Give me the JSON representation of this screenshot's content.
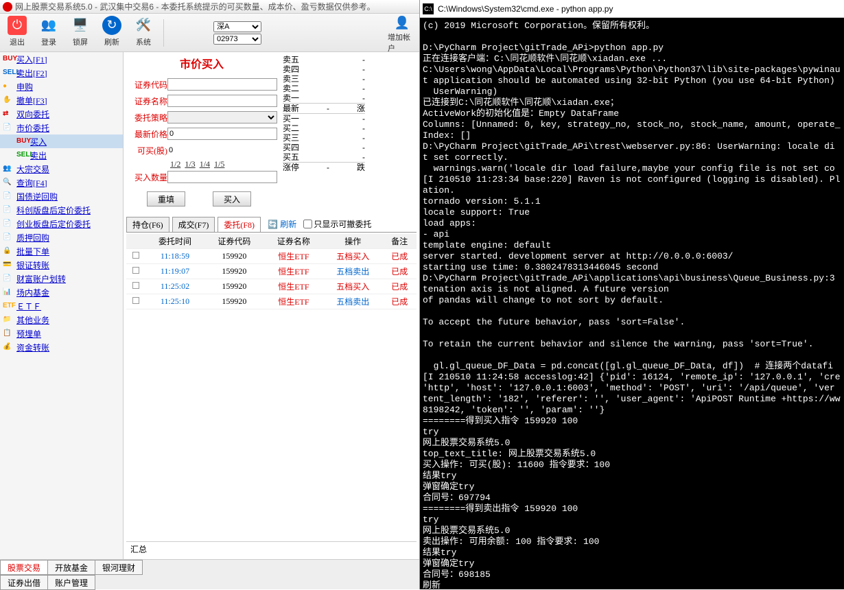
{
  "title": "网上股票交易系统5.0 - 武汉集中交易6 - 本委托系统提示的可买数量、成本价、盈亏数据仅供参考。",
  "toolbar": {
    "exit": "退出",
    "login": "登录",
    "lock": "锁屏",
    "refresh": "刷新",
    "system": "系统",
    "addacct": "增加帐户",
    "sel1": "深A",
    "sel2": "02973"
  },
  "sidebar": [
    {
      "t": "买入[F1]",
      "i": "BUY",
      "c": "#d00"
    },
    {
      "t": "卖出[F2]",
      "i": "SELL",
      "c": "#06c"
    },
    {
      "t": "申购",
      "i": "●",
      "c": "#fa0"
    },
    {
      "t": "撤单[F3]",
      "i": "✋",
      "c": "#fa0"
    },
    {
      "t": "双向委托",
      "i": "⇄",
      "c": "#d00"
    },
    {
      "t": "市价委托",
      "i": "📄",
      "c": "#fa0"
    },
    {
      "t": "买入",
      "i": "BUY",
      "c": "#d00",
      "sub": true,
      "active": true
    },
    {
      "t": "卖出",
      "i": "SELL",
      "c": "#090",
      "sub": true
    },
    {
      "t": "大宗交易",
      "i": "👥",
      "c": "#06c"
    },
    {
      "t": "查询[F4]",
      "i": "🔍",
      "c": "#fa0"
    },
    {
      "t": "国债逆回购",
      "i": "📄",
      "c": "#fa0"
    },
    {
      "t": "科创版盘后定价委托",
      "i": "📄",
      "c": "#fa0"
    },
    {
      "t": "创业板盘后定价委托",
      "i": "📄",
      "c": "#fa0"
    },
    {
      "t": "质押回购",
      "i": "📄",
      "c": "#999"
    },
    {
      "t": "批量下单",
      "i": "🔒",
      "c": "#d00"
    },
    {
      "t": "银证转账",
      "i": "💳",
      "c": "#06c"
    },
    {
      "t": "财富账户划转",
      "i": "📄",
      "c": "#d00"
    },
    {
      "t": "场内基金",
      "i": "📊",
      "c": "#d00"
    },
    {
      "t": "ＥＴＦ",
      "i": "ETF",
      "c": "#fa0"
    },
    {
      "t": "其他业务",
      "i": "📁",
      "c": "#06c"
    },
    {
      "t": "预埋单",
      "i": "📋",
      "c": "#d00"
    },
    {
      "t": "资金转账",
      "i": "💰",
      "c": "#06c"
    }
  ],
  "form": {
    "title": "市价买入",
    "code_l": "证券代码",
    "name_l": "证券名称",
    "strat_l": "委托策略",
    "price_l": "最新价格",
    "avail_l": "可买(股)",
    "qty_l": "买入数量",
    "price_v": "0",
    "avail_v": "0",
    "f1": "1/2",
    "f2": "1/3",
    "f3": "1/4",
    "f4": "1/5",
    "reset": "重填",
    "buy": "买入"
  },
  "quotes": {
    "s5": "卖五",
    "s4": "卖四",
    "s3": "卖三",
    "s2": "卖二",
    "s1": "卖一",
    "newest": "最新",
    "newtail": "涨",
    "b1": "买一",
    "b2": "买二",
    "b3": "买三",
    "b4": "买四",
    "b5": "买五",
    "zt": "涨停",
    "dt": "跌",
    "dash": "-"
  },
  "tabs": {
    "hold": "持仓(F6)",
    "deal": "成交(F7)",
    "order": "委托(F8)",
    "refresh": "刷新",
    "onlycancel": "只显示可撤委托"
  },
  "thead": {
    "time": "委托时间",
    "code": "证券代码",
    "name": "证券名称",
    "op": "操作",
    "note": "备注"
  },
  "orders": [
    {
      "time": "11:18:59",
      "code": "159920",
      "name": "恒生ETF",
      "op": "五档买入",
      "opc": "red",
      "note": "已成"
    },
    {
      "time": "11:19:07",
      "code": "159920",
      "name": "恒生ETF",
      "op": "五档卖出",
      "opc": "blue",
      "note": "已成"
    },
    {
      "time": "11:25:02",
      "code": "159920",
      "name": "恒生ETF",
      "op": "五档买入",
      "opc": "red",
      "note": "已成"
    },
    {
      "time": "11:25:10",
      "code": "159920",
      "name": "恒生ETF",
      "op": "五档卖出",
      "opc": "blue",
      "note": "已成"
    }
  ],
  "bottom": {
    "r1": [
      "股票交易",
      "开放基金",
      "银河理财"
    ],
    "r2": [
      "证券出借",
      "账户管理"
    ],
    "total": "汇总"
  },
  "cmd": {
    "title": "C:\\Windows\\System32\\cmd.exe - python  app.py",
    "body": "(c) 2019 Microsoft Corporation。保留所有权利。\n\nD:\\PyCharm Project\\gitTrade_APi>python app.py\n正在连接客户端：C:\\同花顺软件\\同花顺\\xiadan.exe ...\nC:\\Users\\wong\\AppData\\Local\\Programs\\Python\\Python37\\lib\\site-packages\\pywinau\nt application should be automated using 32-bit Python (you use 64-bit Python)\n  UserWarning)\n已连接到C:\\同花顺软件\\同花顺\\xiadan.exe；\nActiveWork的初始化值是：Empty DataFrame\nColumns: [Unnamed: 0, key, strategy_no, stock_no, stock_name, amount, operate_\nIndex: []\nD:\\PyCharm Project\\gitTrade_APi\\trest\\webserver.py:86: UserWarning: locale di\nt set correctly.\n  warnings.warn('locale dir load failure,maybe your config file is not set co\n[I 210510 11:23:34 base:220] Raven is not configured (logging is disabled). Pl\nation.\ntornado version: 5.1.1\nlocale support: True\nload apps:\n- api\ntemplate engine: default\nserver started. development server at http://0.0.0.0:6003/\nstarting use time: 0.3802478313446045 second\nD:\\PyCharm Project\\gitTrade_APi\\applications\\api\\business\\Queue_Business.py:3\ntenation axis is not aligned. A future version\nof pandas will change to not sort by default.\n\nTo accept the future behavior, pass 'sort=False'.\n\nTo retain the current behavior and silence the warning, pass 'sort=True'.\n\n  gl.gl_queue_DF_Data = pd.concat([gl.gl_queue_DF_Data, df])  # 连接两个datafi\n[I 210510 11:24:58 accesslog:42] {'pid': 16124, 'remote_ip': '127.0.0.1', 'cre\n'http', 'host': '127.0.0.1:6003', 'method': 'POST', 'uri': '/api/queue', 'ver\ntent_length': '182', 'referer': '', 'user_agent': 'ApiPOST Runtime +https://ww\n8198242, 'token': '', 'param': ''}\n========得到买入指令 159920 100\ntry\n网上股票交易系统5.0\ntop_text_title: 网上股票交易系统5.0\n买入操作: 可买(股): 11600 指令要求：100\n结果try\n弹窗确定try\n合同号：697794\n========得到卖出指令 159920 100\ntry\n网上股票交易系统5.0\n卖出操作: 可用余额: 100 指令要求: 100\n结果try\n弹窗确定try\n合同号：698185\n刷新"
  }
}
